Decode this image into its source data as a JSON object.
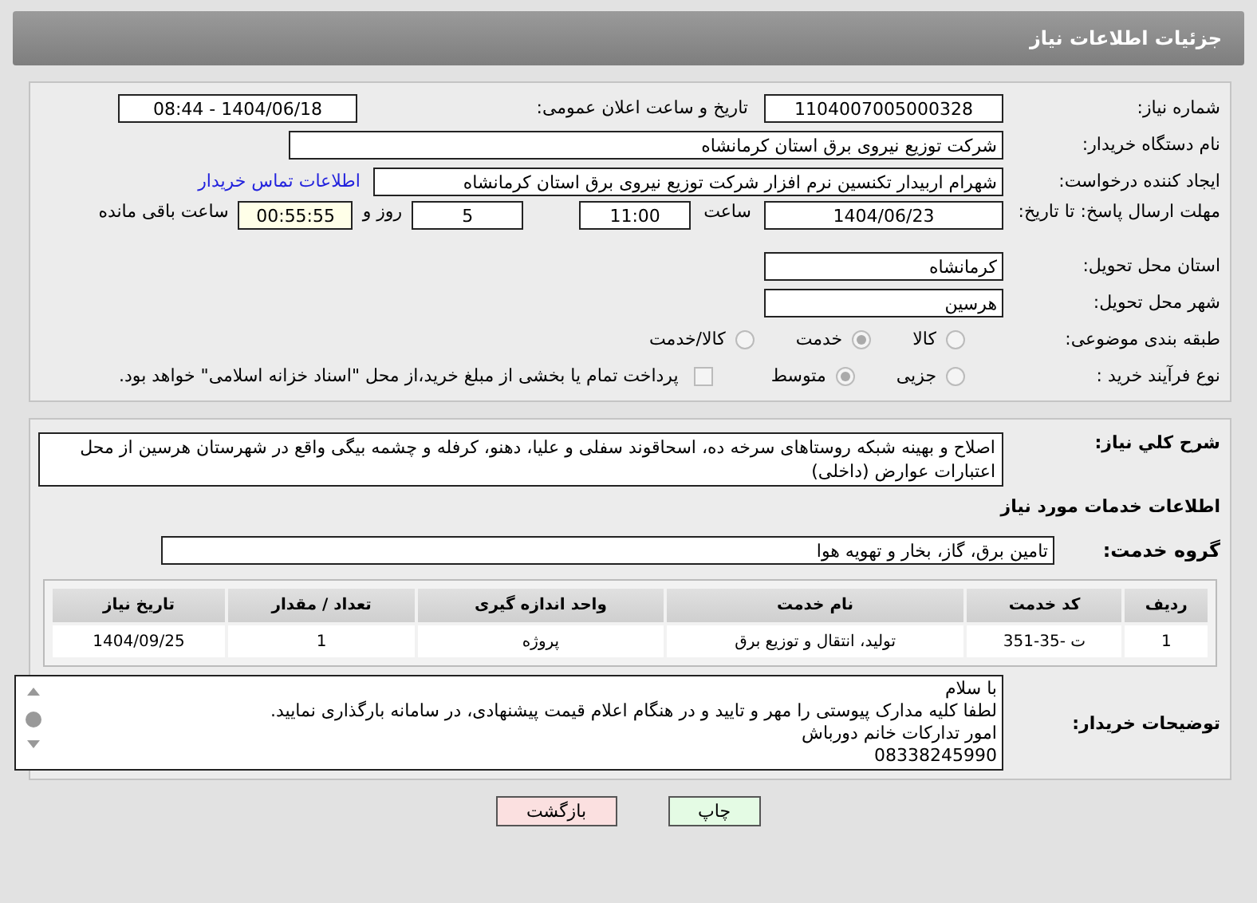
{
  "header": {
    "title": "جزئیات اطلاعات نیاز"
  },
  "need_number": {
    "label": "شماره نیاز:",
    "value": "1104007005000328"
  },
  "announce": {
    "label": "تاریخ و ساعت اعلان عمومی:",
    "value": "1404/06/18 - 08:44"
  },
  "buyer_org": {
    "label": "نام دستگاه خریدار:",
    "value": "شرکت توزیع نیروی برق استان کرمانشاه"
  },
  "requester": {
    "label": "ایجاد کننده درخواست:",
    "value": "شهرام اربیدار تکنسین نرم افزار شرکت توزیع نیروی برق استان کرمانشاه",
    "link": "اطلاعات تماس خریدار"
  },
  "deadline": {
    "label": "مهلت ارسال پاسخ: تا تاریخ:",
    "date": "1404/06/23",
    "time_label": "ساعت",
    "time": "11:00",
    "days": "5",
    "days_label": "روز و",
    "remaining": "00:55:55",
    "remaining_label": "ساعت باقی مانده"
  },
  "province": {
    "label": "استان محل تحویل:",
    "value": "کرمانشاه"
  },
  "city": {
    "label": "شهر محل تحویل:",
    "value": "هرسین"
  },
  "category": {
    "label": "طبقه بندی موضوعی:",
    "options": [
      {
        "label": "کالا",
        "selected": false
      },
      {
        "label": "خدمت",
        "selected": true
      },
      {
        "label": "کالا/خدمت",
        "selected": false
      }
    ]
  },
  "purchase_process": {
    "label": "نوع فرآیند خرید :",
    "options": [
      {
        "label": "جزیی",
        "selected": false
      },
      {
        "label": "متوسط",
        "selected": true
      }
    ],
    "payment": {
      "label": "پرداخت تمام یا بخشی از مبلغ خرید،از محل \"اسناد خزانه اسلامی\" خواهد بود.",
      "checked": false
    }
  },
  "description": {
    "label": "شرح کلي نياز:",
    "value": "اصلاح و بهینه شبکه روستاهای سرخه ده، اسحاقوند سفلی و علیا، دهنو، کرفله و چشمه بیگی واقع در شهرستان هرسین از محل اعتبارات عوارض (داخلی)"
  },
  "services": {
    "title": "اطلاعات خدمات مورد نیاز"
  },
  "service_group": {
    "label": "گروه خدمت:",
    "value": "تامین برق، گاز، بخار و تهویه هوا"
  },
  "table": {
    "columns": [
      "ردیف",
      "کد خدمت",
      "نام خدمت",
      "واحد اندازه گیری",
      "تعداد / مقدار",
      "تاریخ نیاز"
    ],
    "rows": [
      [
        "1",
        "ت -35-351",
        "تولید، انتقال و توزیع برق",
        "پروژه",
        "1",
        "1404/09/25"
      ]
    ]
  },
  "buyer_notes": {
    "label": "توضیحات خریدار:",
    "lines": [
      "با سلام",
      "لطفا کلیه مدارک پیوستی را مهر و تایید و در هنگام اعلام قیمت پیشنهادی، در سامانه بارگذاری نمایید.",
      "امور تدارکات خانم دورباش",
      "08338245990"
    ]
  },
  "buttons": [
    {
      "label": "چاپ",
      "kind": "print"
    },
    {
      "label": "بازگشت",
      "kind": "back"
    }
  ]
}
